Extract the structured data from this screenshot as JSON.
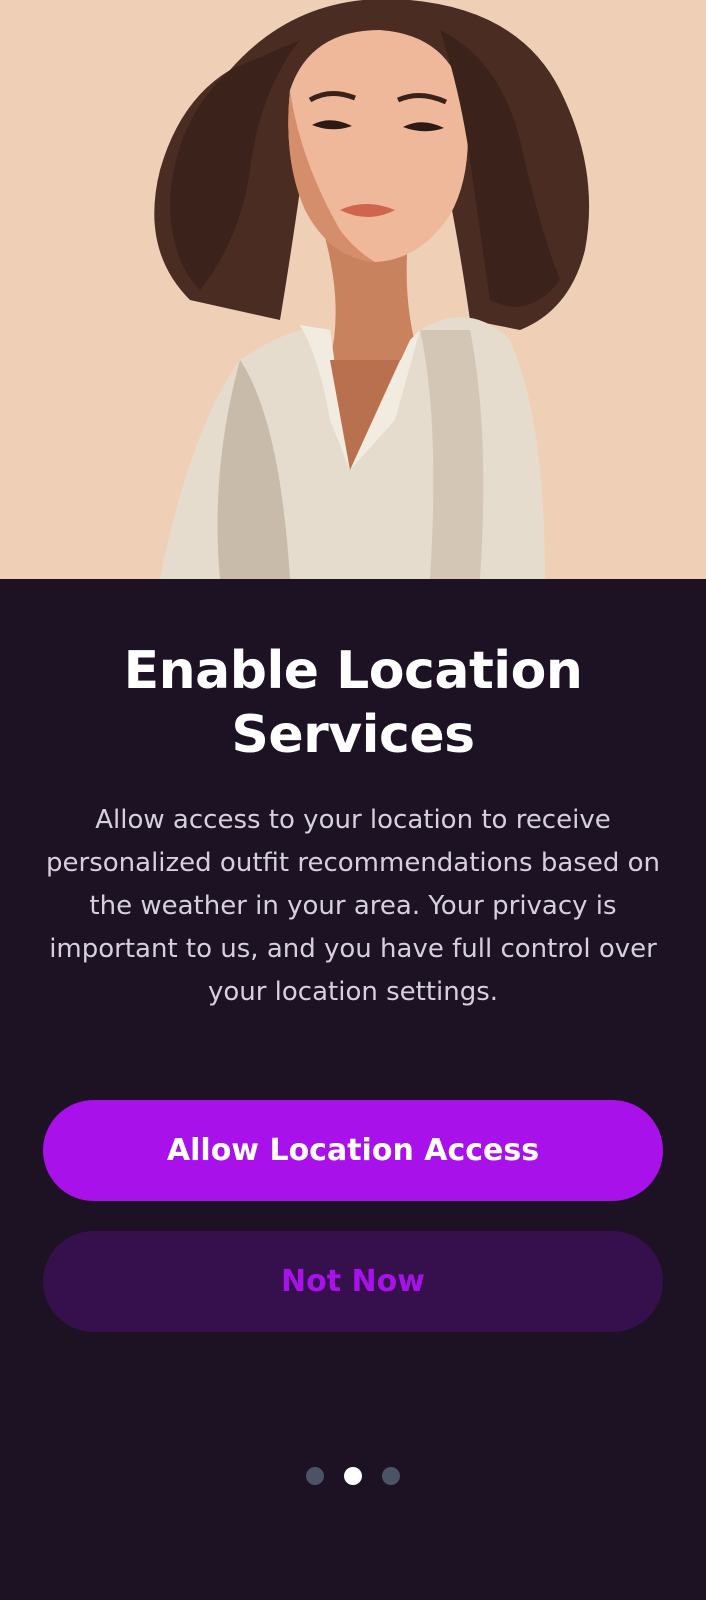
{
  "hero": {
    "image": "woman-illustration",
    "background_color": "#efd0b6"
  },
  "onboarding": {
    "title": "Enable Location Services",
    "description": "Allow access to your location to receive personalized outfit recommendations based on the weather in your area. Your privacy is important to us, and you have full control over your location settings."
  },
  "actions": {
    "primary_label": "Allow Location Access",
    "secondary_label": "Not Now"
  },
  "pagination": {
    "total_pages": 3,
    "current_page": 2
  },
  "colors": {
    "background": "#1d1124",
    "accent": "#a811ea",
    "secondary_button": "#36104c",
    "dot_inactive": "#4a5466",
    "dot_active": "#ffffff"
  }
}
